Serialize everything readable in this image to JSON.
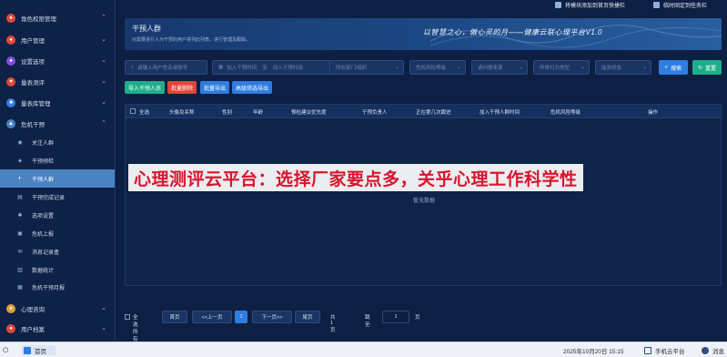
{
  "sidebar": {
    "items": [
      {
        "label": "角色权限管理",
        "icon": "role-icon",
        "color": "#e04a3b",
        "chevron": "^"
      },
      {
        "label": "用户管理",
        "icon": "user-icon",
        "color": "#e04a3b",
        "chevron": "v"
      },
      {
        "label": "设置选项",
        "icon": "settings-icon",
        "color": "#7d4fe0",
        "chevron": "v"
      },
      {
        "label": "量表测评",
        "icon": "heart-icon",
        "color": "#e04a3b",
        "chevron": "v"
      },
      {
        "label": "量表库管理",
        "icon": "book-icon",
        "color": "#3b7be0",
        "chevron": "v"
      },
      {
        "label": "危机干预",
        "icon": "crisis-icon",
        "color": "#4a82c4",
        "chevron": "^"
      }
    ],
    "subitems": [
      {
        "label": "关注人群",
        "icon": "focus-icon"
      },
      {
        "label": "干预预检",
        "icon": "precheck-icon"
      },
      {
        "label": "干预人群",
        "icon": "intervene-icon",
        "active": true
      },
      {
        "label": "干预完成记录",
        "icon": "record-icon"
      },
      {
        "label": "选项设置",
        "icon": "gear-icon"
      },
      {
        "label": "危机上报",
        "icon": "report-icon"
      },
      {
        "label": "消息记录盒",
        "icon": "message-icon"
      },
      {
        "label": "数据统计",
        "icon": "chart-icon"
      },
      {
        "label": "危机干预月报",
        "icon": "monthly-icon"
      }
    ],
    "bottom": [
      {
        "label": "心理咨询",
        "icon": "consult-icon",
        "color": "#e0a13b",
        "chevron": "v"
      },
      {
        "label": "用户档案",
        "icon": "archive-icon",
        "color": "#e04a3b",
        "chevron": "v"
      }
    ]
  },
  "topbar": {
    "btn1": "将模块添加到首页快捷栏",
    "btn2": "临时固定到任务栏"
  },
  "banner": {
    "title": "干预人群",
    "desc": "对需要进行人为干预的用户将列此列表，进行管理及跟踪。",
    "slogan": "以智慧之心，做心灵的月——健康云联心理平台V1.0"
  },
  "filters": {
    "name": "请输入用户姓名或账号",
    "date_from": "加入干预时间",
    "date_sep": "至",
    "date_to": "加入干预时间",
    "dept": "所在部门/组织",
    "risk": "危机风险等级",
    "source": "请问题来源",
    "behavior": "异常行为类型",
    "status": "监测状态",
    "search": "搜索",
    "reset": "重置"
  },
  "actions": {
    "import": "导入干预人员",
    "delete": "批量删除",
    "export": "批量导出",
    "filter_export": "高级筛选导出"
  },
  "table": {
    "columns": [
      "全选",
      "头像及名称",
      "性别",
      "年龄",
      "预检建议优先度",
      "干预负责人",
      "正在第几次跟进",
      "加入干预人群时间",
      "危机风险等级",
      "操作"
    ],
    "empty": "暂无数据"
  },
  "pager": {
    "select_all": "全选所有",
    "first": "首页",
    "prev": "<<上一页",
    "current": "1",
    "next": "下一页>>",
    "last": "尾页",
    "total": "共1页",
    "jump_label": "跳至:",
    "jump_value": "1",
    "page_unit": "页"
  },
  "overlay": "心理测评云平台：选择厂家要点多，关乎心理工作科学性",
  "taskbar": {
    "home": "首页",
    "datetime": "2025年10月20日 15:15",
    "cloud": "手机云平台",
    "message": "消息"
  }
}
